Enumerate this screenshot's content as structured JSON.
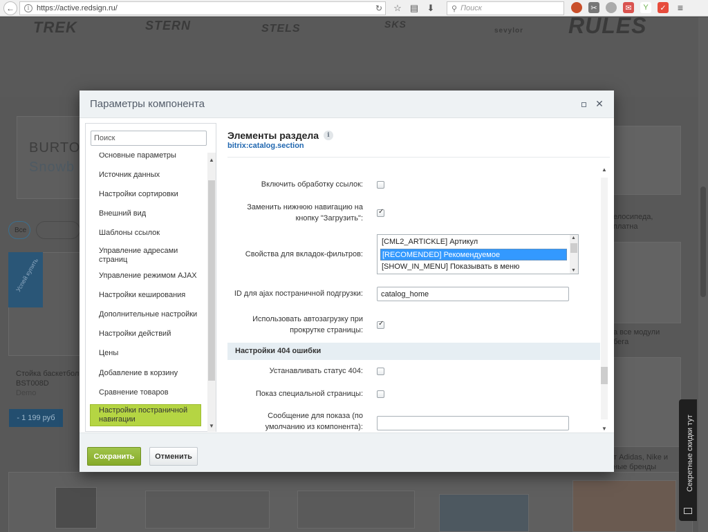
{
  "browser": {
    "url": "https://active.redsign.ru/",
    "search_placeholder": "Поиск"
  },
  "background": {
    "brands": [
      "TREK",
      "STERN",
      "STELS",
      "SKS",
      "sevylor",
      "RULES"
    ],
    "left_banner": [
      "BURTO",
      "Snowb"
    ],
    "filter_pill": "Все",
    "ribbon": "Успей купить",
    "product_name": "Стойка баскетболь",
    "product_code": "BST008D",
    "product_brand": "Demo",
    "price": "- 1 199 руб",
    "right_text_1": "елосипеда,",
    "right_text_1b": "платна",
    "right_text_2": "а все модули",
    "right_text_2b": "бега",
    "right_text_3": "т Adidas, Nike и",
    "right_text_3b": "ные бренды",
    "side_tab": "Секретные скидки тут"
  },
  "modal": {
    "title": "Параметры компонента",
    "search_placeholder": "Поиск",
    "nav_items": [
      "Основные параметры",
      "Источник данных",
      "Настройки сортировки",
      "Внешний вид",
      "Шаблоны ссылок",
      "Управление адресами страниц",
      "Управление режимом AJAX",
      "Настройки кеширования",
      "Дополнительные настройки",
      "Настройки действий",
      "Цены",
      "Добавление в корзину",
      "Сравнение товаров",
      "Настройки постраничной навигации"
    ],
    "active_nav_index": 13,
    "content_title": "Элементы раздела",
    "content_subtitle": "bitrix:catalog.section",
    "rows": {
      "enable_links_label": "Включить обработку ссылок:",
      "enable_links_checked": false,
      "replace_nav_label": "Заменить нижнюю навигацию на кнопку \"Загрузить\":",
      "replace_nav_checked": true,
      "tab_filter_label": "Свойства для вкладок-фильтров:",
      "tab_filter_options": [
        "[CML2_ARTICKLE] Артикул",
        "[RECOMENDED] Рекомендуемое",
        "[SHOW_IN_MENU] Показывать в меню"
      ],
      "tab_filter_selected_index": 1,
      "ajax_id_label": "ID для ajax постраничной подгрузки:",
      "ajax_id_value": "catalog_home",
      "autoload_label": "Использовать автозагрузку при прокрутке страницы:",
      "autoload_checked": true,
      "section_404": "Настройки 404 ошибки",
      "set_404_label": "Устанавливать статус 404:",
      "set_404_checked": false,
      "show_page_label": "Показ специальной страницы:",
      "show_page_checked": false,
      "message_label": "Сообщение для показа (по умолчанию из компонента):",
      "message_value": ""
    },
    "save_label": "Сохранить",
    "cancel_label": "Отменить"
  }
}
